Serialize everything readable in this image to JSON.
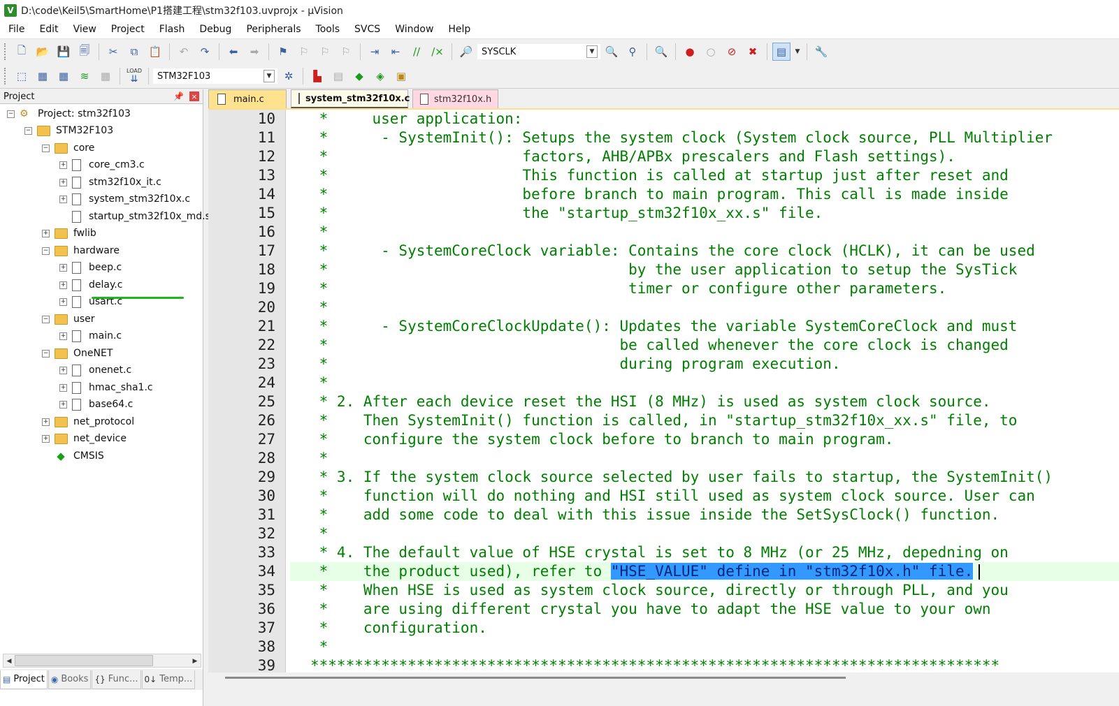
{
  "window": {
    "title": "D:\\code\\Keil5\\SmartHome\\P1搭建工程\\stm32f103.uvprojx - µVision",
    "app_icon_letter": "V"
  },
  "menu": [
    "File",
    "Edit",
    "View",
    "Project",
    "Flash",
    "Debug",
    "Peripherals",
    "Tools",
    "SVCS",
    "Window",
    "Help"
  ],
  "toolbar": {
    "find_combo": "SYSCLK",
    "target_combo": "STM32F103",
    "load_label": "LOAD"
  },
  "project_panel": {
    "title": "Project",
    "pin_glyph": "📌",
    "close_glyph": "×",
    "tree": {
      "project": "Project: stm32f103",
      "target": "STM32F103",
      "core": "core",
      "core_cm3": "core_cm3.c",
      "stm32_it": "stm32f10x_it.c",
      "system_stm32": "system_stm32f10x.c",
      "startup": "startup_stm32f10x_md.s",
      "fwlib": "fwlib",
      "hardware": "hardware",
      "beep": "beep.c",
      "delay": "delay.c",
      "usart": "usart.c",
      "user": "user",
      "main": "main.c",
      "onenet_group": "OneNET",
      "onenet": "onenet.c",
      "hmac": "hmac_sha1.c",
      "base64": "base64.c",
      "net_protocol": "net_protocol",
      "net_device": "net_device",
      "cmsis": "CMSIS"
    },
    "tabs": [
      "Project",
      "Books",
      "Func...",
      "Temp..."
    ]
  },
  "editor": {
    "tabs": [
      "main.c",
      "system_stm32f10x.c",
      "stm32f10x.h"
    ],
    "active_tab": "system_stm32f10x.c",
    "lines": [
      {
        "n": "10",
        "t": " *     user application:"
      },
      {
        "n": "11",
        "t": " *      - SystemInit(): Setups the system clock (System clock source, PLL Multiplier"
      },
      {
        "n": "12",
        "t": " *                      factors, AHB/APBx prescalers and Flash settings)."
      },
      {
        "n": "13",
        "t": " *                      This function is called at startup just after reset and"
      },
      {
        "n": "14",
        "t": " *                      before branch to main program. This call is made inside"
      },
      {
        "n": "15",
        "t": " *                      the \"startup_stm32f10x_xx.s\" file."
      },
      {
        "n": "16",
        "t": " *"
      },
      {
        "n": "17",
        "t": " *      - SystemCoreClock variable: Contains the core clock (HCLK), it can be used"
      },
      {
        "n": "18",
        "t": " *                                  by the user application to setup the SysTick"
      },
      {
        "n": "19",
        "t": " *                                  timer or configure other parameters."
      },
      {
        "n": "20",
        "t": " *"
      },
      {
        "n": "21",
        "t": " *      - SystemCoreClockUpdate(): Updates the variable SystemCoreClock and must"
      },
      {
        "n": "22",
        "t": " *                                 be called whenever the core clock is changed"
      },
      {
        "n": "23",
        "t": " *                                 during program execution."
      },
      {
        "n": "24",
        "t": " *"
      },
      {
        "n": "25",
        "t": " * 2. After each device reset the HSI (8 MHz) is used as system clock source."
      },
      {
        "n": "26",
        "t": " *    Then SystemInit() function is called, in \"startup_stm32f10x_xx.s\" file, to"
      },
      {
        "n": "27",
        "t": " *    configure the system clock before to branch to main program."
      },
      {
        "n": "28",
        "t": " *"
      },
      {
        "n": "29",
        "t": " * 3. If the system clock source selected by user fails to startup, the SystemInit()"
      },
      {
        "n": "30",
        "t": " *    function will do nothing and HSI still used as system clock source. User can"
      },
      {
        "n": "31",
        "t": " *    add some code to deal with this issue inside the SetSysClock() function."
      },
      {
        "n": "32",
        "t": " *"
      },
      {
        "n": "33",
        "t": " * 4. The default value of HSE crystal is set to 8 MHz (or 25 MHz, depedning on"
      },
      {
        "n": "34",
        "t": " *    the product used), refer to ",
        "sel": "\"HSE_VALUE\" define in \"stm32f10x.h\" file."
      },
      {
        "n": "35",
        "t": " *    When HSE is used as system clock source, directly or through PLL, and you"
      },
      {
        "n": "36",
        "t": " *    are using different crystal you have to adapt the HSE value to your own"
      },
      {
        "n": "37",
        "t": " *    configuration."
      },
      {
        "n": "38",
        "t": " *"
      },
      {
        "n": "39",
        "t": "******************************************************************************"
      }
    ],
    "highlighted_line": "34"
  }
}
